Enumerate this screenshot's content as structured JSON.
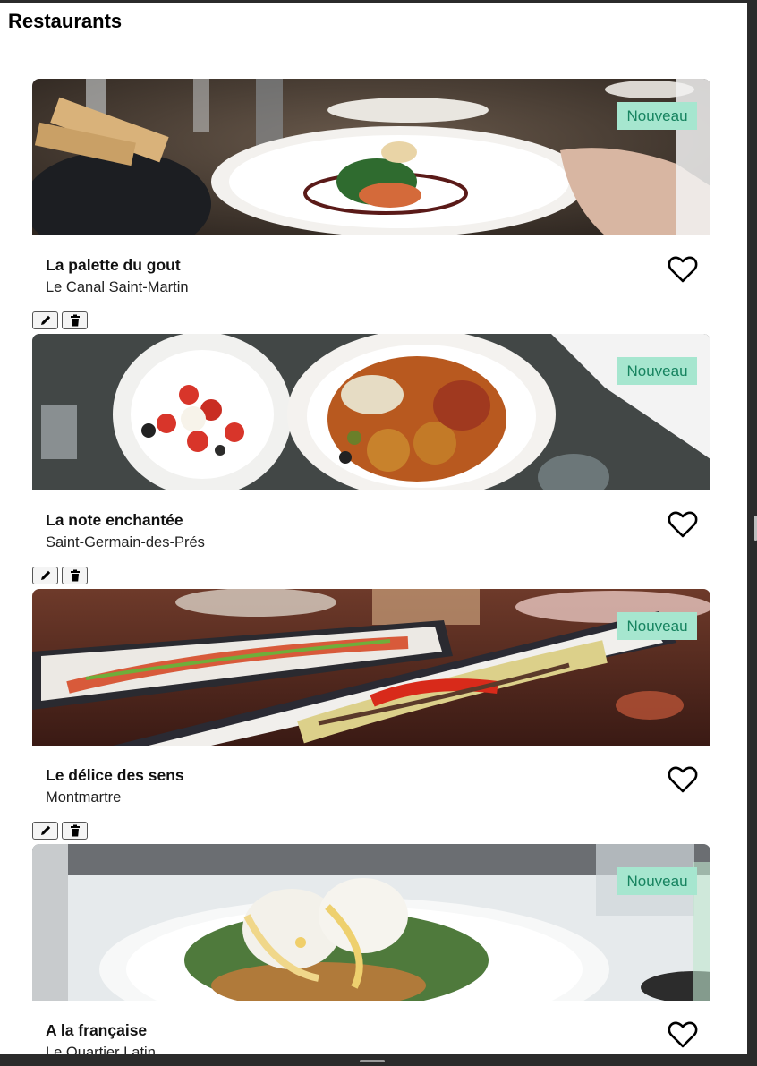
{
  "page": {
    "title": "Restaurants"
  },
  "restaurants": [
    {
      "name": "La palette du gout",
      "location": "Le Canal Saint-Martin",
      "badge": "Nouveau",
      "favorite": false
    },
    {
      "name": "La note enchantée",
      "location": "Saint-Germain-des-Prés",
      "badge": "Nouveau",
      "favorite": false
    },
    {
      "name": "Le délice des sens",
      "location": "Montmartre",
      "badge": "Nouveau",
      "favorite": false
    },
    {
      "name": "A la française",
      "location": "Le Quartier Latin",
      "badge": "Nouveau",
      "favorite": false
    }
  ],
  "icons": {
    "favorite": "heart-outline-icon",
    "edit": "pencil-icon",
    "delete": "trash-icon"
  },
  "colors": {
    "badge_background": "#a6e6cf",
    "badge_text": "#16835f",
    "frame": "#2b2b2b"
  }
}
